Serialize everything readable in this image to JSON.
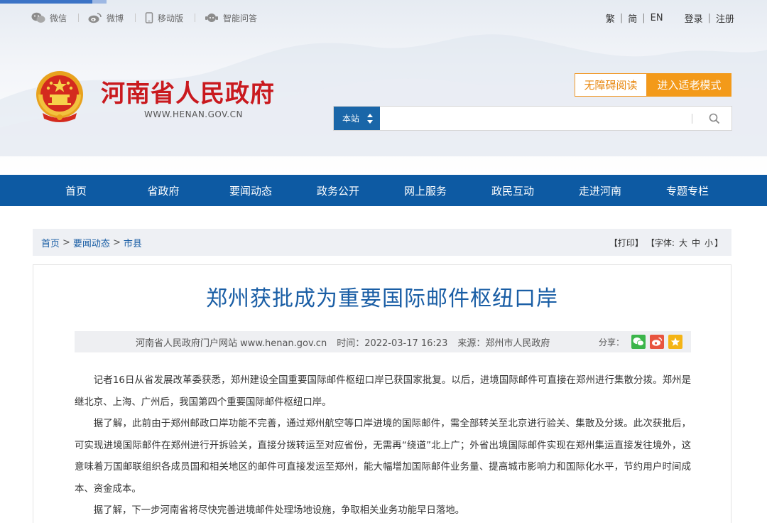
{
  "topbar": {
    "wechat": "微信",
    "weibo": "微博",
    "mobile": "移动版",
    "assistant": "智能问答",
    "lang_traditional": "繁",
    "lang_simplified": "简",
    "lang_en": "EN",
    "login": "登录",
    "register": "注册"
  },
  "header": {
    "title": "河南省人民政府",
    "url": "WWW.HENAN.GOV.CN",
    "accessible_btn": "无障碍阅读",
    "elder_btn": "进入适老模式"
  },
  "search": {
    "scope": "本站",
    "value": "",
    "placeholder": ""
  },
  "nav": {
    "items": [
      "首页",
      "省政府",
      "要闻动态",
      "政务公开",
      "网上服务",
      "政民互动",
      "走进河南",
      "专题专栏"
    ]
  },
  "breadcrumb": {
    "items": [
      "首页",
      "要闻动态",
      "市县"
    ],
    "print": "【打印】",
    "font_label": "【字体:",
    "size_large": "大",
    "size_medium": "中",
    "size_small": "小",
    "font_close": "】"
  },
  "article": {
    "title": "郑州获批成为重要国际邮件枢纽口岸",
    "source_site": "河南省人民政府门户网站 www.henan.gov.cn",
    "time": "时间：2022-03-17 16:23",
    "origin": "来源：郑州市人民政府",
    "share_label": "分享：",
    "paragraphs": [
      "记者16日从省发展改革委获悉，郑州建设全国重要国际邮件枢纽口岸已获国家批复。以后，进境国际邮件可直接在郑州进行集散分拨。郑州是继北京、上海、广州后，我国第四个重要国际邮件枢纽口岸。",
      "据了解，此前由于郑州邮政口岸功能不完善，通过郑州航空等口岸进境的国际邮件，需全部转关至北京进行验关、集散及分拨。此次获批后，可实现进境国际邮件在郑州进行开拆验关，直接分拨转运至对应省份，无需再“绕道”北上广；外省出境国际邮件实现在郑州集运直接发往境外，这意味着万国邮联组织各成员国和相关地区的邮件可直接发运至郑州，能大幅增加国际邮件业务量、提高城市影响力和国际化水平，节约用户时间成本、资金成本。",
      "据了解，下一步河南省将尽快完善进境邮件处理场地设施，争取相关业务功能早日落地。"
    ]
  },
  "colors": {
    "nav_blue": "#0d5aa3",
    "title_red": "#c9191e",
    "orange": "#f39a1a",
    "link_blue": "#1a5ea5"
  }
}
